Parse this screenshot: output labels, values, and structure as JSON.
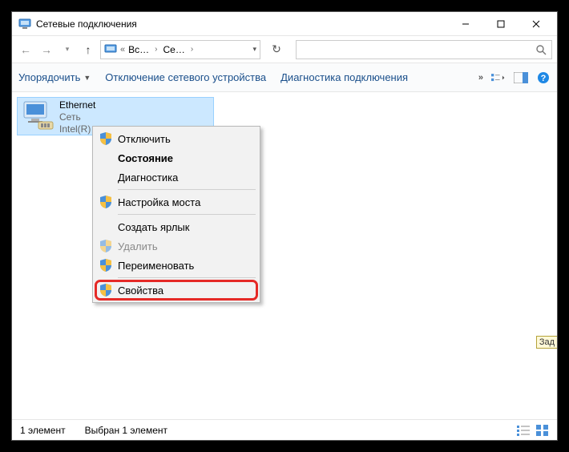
{
  "titlebar": {
    "title": "Сетевые подключения"
  },
  "address": {
    "p1": "Вс…",
    "p2": "Се…"
  },
  "toolbar": {
    "organize": "Упорядочить",
    "disable": "Отключение сетевого устройства",
    "diagnose": "Диагностика подключения"
  },
  "nic": {
    "name": "Ethernet",
    "line2": "Сеть",
    "line3": "Intel(R)"
  },
  "ctx": {
    "disable": "Отключить",
    "status": "Состояние",
    "diag": "Диагностика",
    "bridge": "Настройка моста",
    "shortcut": "Создать ярлык",
    "delete": "Удалить",
    "rename": "Переименовать",
    "props": "Свойства"
  },
  "statusbar": {
    "count": "1 элемент",
    "selected": "Выбран 1 элемент"
  },
  "tooltip": "Зад"
}
